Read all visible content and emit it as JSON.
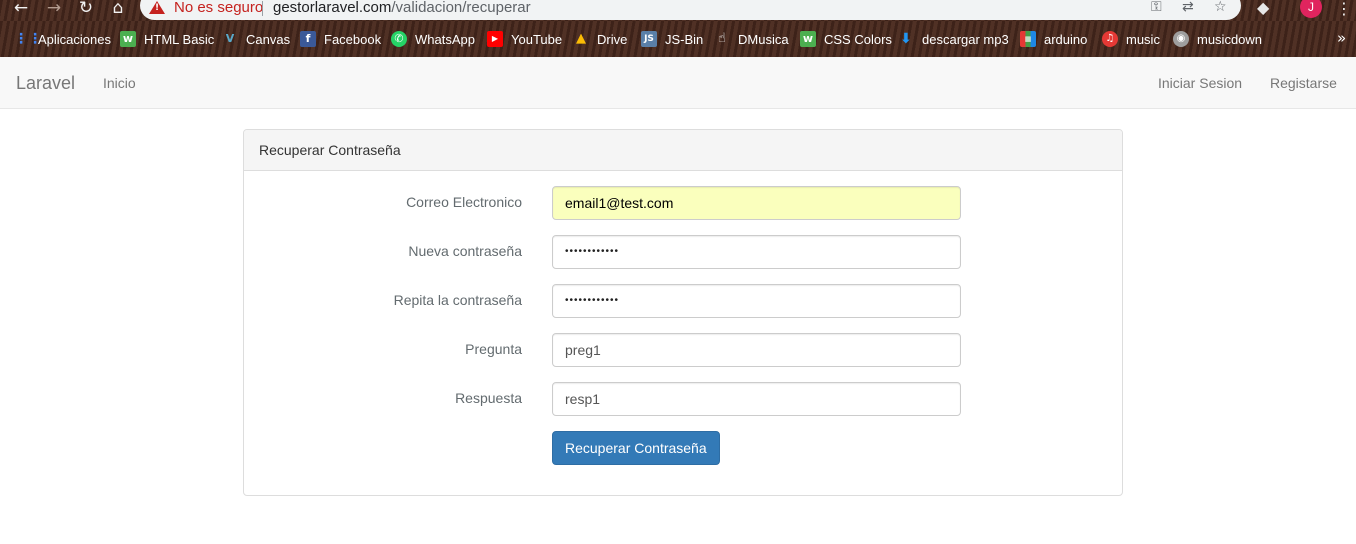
{
  "browser": {
    "security_label": "No es seguro",
    "url_domain": "gestorlaravel.com",
    "url_path": "/validacion/recuperar",
    "profile_initial": "J"
  },
  "bookmarks": [
    {
      "label": "Aplicaciones",
      "icon": "apps-grid-icon",
      "color": "#ffffff"
    },
    {
      "label": "HTML Basic",
      "icon": "w3schools-icon",
      "color": "#4caf50"
    },
    {
      "label": "Canvas",
      "icon": "canvas-v-icon",
      "color": "#1c6e8c"
    },
    {
      "label": "Facebook",
      "icon": "facebook-icon",
      "color": "#3b5998"
    },
    {
      "label": "WhatsApp",
      "icon": "whatsapp-icon",
      "color": "#25d366"
    },
    {
      "label": "YouTube",
      "icon": "youtube-icon",
      "color": "#ff0000"
    },
    {
      "label": "Drive",
      "icon": "google-drive-icon",
      "color": "#fbbc04"
    },
    {
      "label": "JS-Bin",
      "icon": "jsbin-icon",
      "color": "#5a7fa8"
    },
    {
      "label": "DMusica",
      "icon": "pointer-hand-icon",
      "color": "#ffffff"
    },
    {
      "label": "CSS Colors",
      "icon": "w3schools-icon",
      "color": "#4caf50"
    },
    {
      "label": "descargar mp3",
      "icon": "download-icon",
      "color": "#2196f3"
    },
    {
      "label": "arduino",
      "icon": "html-color-icon",
      "color": "#e53935"
    },
    {
      "label": "music",
      "icon": "music-note-icon",
      "color": "#e53935"
    },
    {
      "label": "musicdown",
      "icon": "globe-icon",
      "color": "#9e9e9e"
    }
  ],
  "navbar": {
    "brand": "Laravel",
    "home": "Inicio",
    "login": "Iniciar Sesion",
    "register": "Registarse"
  },
  "panel": {
    "title": "Recuperar Contraseña"
  },
  "form": {
    "email_label": "Correo Electronico",
    "email_value": "email1@test.com",
    "new_password_label": "Nueva contraseña",
    "new_password_value": "••••••••••••",
    "repeat_password_label": "Repita la contraseña",
    "repeat_password_value": "••••••••••••",
    "question_label": "Pregunta",
    "question_value": "preg1",
    "answer_label": "Respuesta",
    "answer_value": "resp1",
    "submit_label": "Recuperar Contraseña"
  },
  "colors": {
    "primary_button": "#337ab7",
    "autofill_background": "#faffbd",
    "insecure_red": "#c5221f"
  }
}
